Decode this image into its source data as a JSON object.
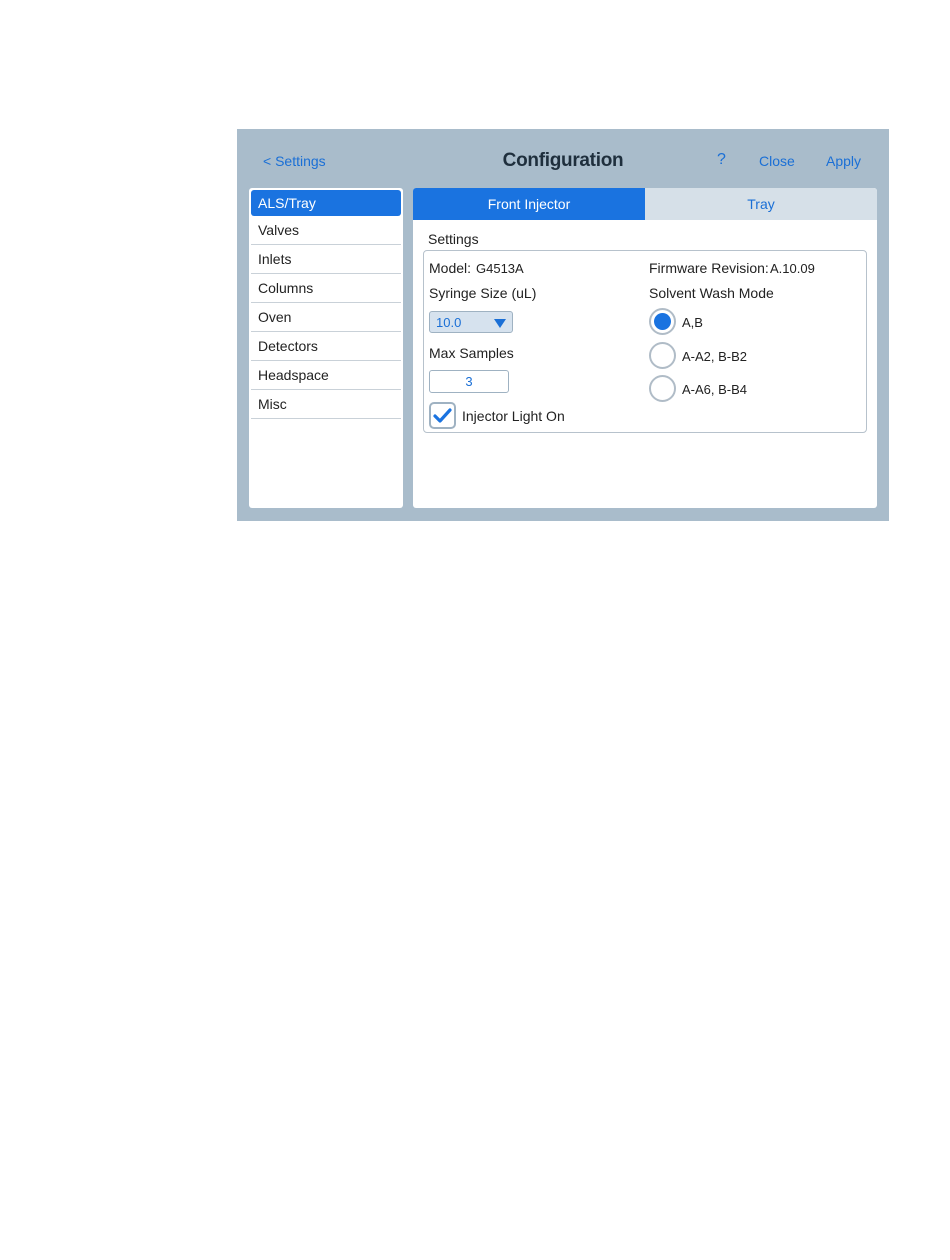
{
  "header": {
    "back_label": "< Settings",
    "title": "Configuration",
    "help_label": "?",
    "close_label": "Close",
    "apply_label": "Apply"
  },
  "sidebar": {
    "items": [
      {
        "label": "ALS/Tray",
        "active": true
      },
      {
        "label": "Valves"
      },
      {
        "label": "Inlets"
      },
      {
        "label": "Columns"
      },
      {
        "label": "Oven"
      },
      {
        "label": "Detectors"
      },
      {
        "label": "Headspace"
      },
      {
        "label": "Misc"
      }
    ]
  },
  "tabs": [
    {
      "label": "Front Injector",
      "active": true
    },
    {
      "label": "Tray"
    }
  ],
  "settings": {
    "section_label": "Settings",
    "model_label": "Model:",
    "model_value": "G4513A",
    "firmware_label": "Firmware Revision:",
    "firmware_value": "A.10.09",
    "syringe_label": "Syringe Size (uL)",
    "syringe_value": "10.0",
    "max_samples_label": "Max Samples",
    "max_samples_value": "3",
    "injector_light_label": "Injector Light On",
    "injector_light_checked": true,
    "solvent_wash_label": "Solvent Wash Mode",
    "solvent_wash_options": [
      {
        "label": "A,B",
        "selected": true
      },
      {
        "label": "A-A2, B-B2"
      },
      {
        "label": "A-A6, B-B4"
      }
    ]
  },
  "colors": {
    "accent": "#1a73e0",
    "link": "#1a6fd6",
    "frame": "#a9bccb",
    "inactive_tab": "#d6e0e8"
  }
}
